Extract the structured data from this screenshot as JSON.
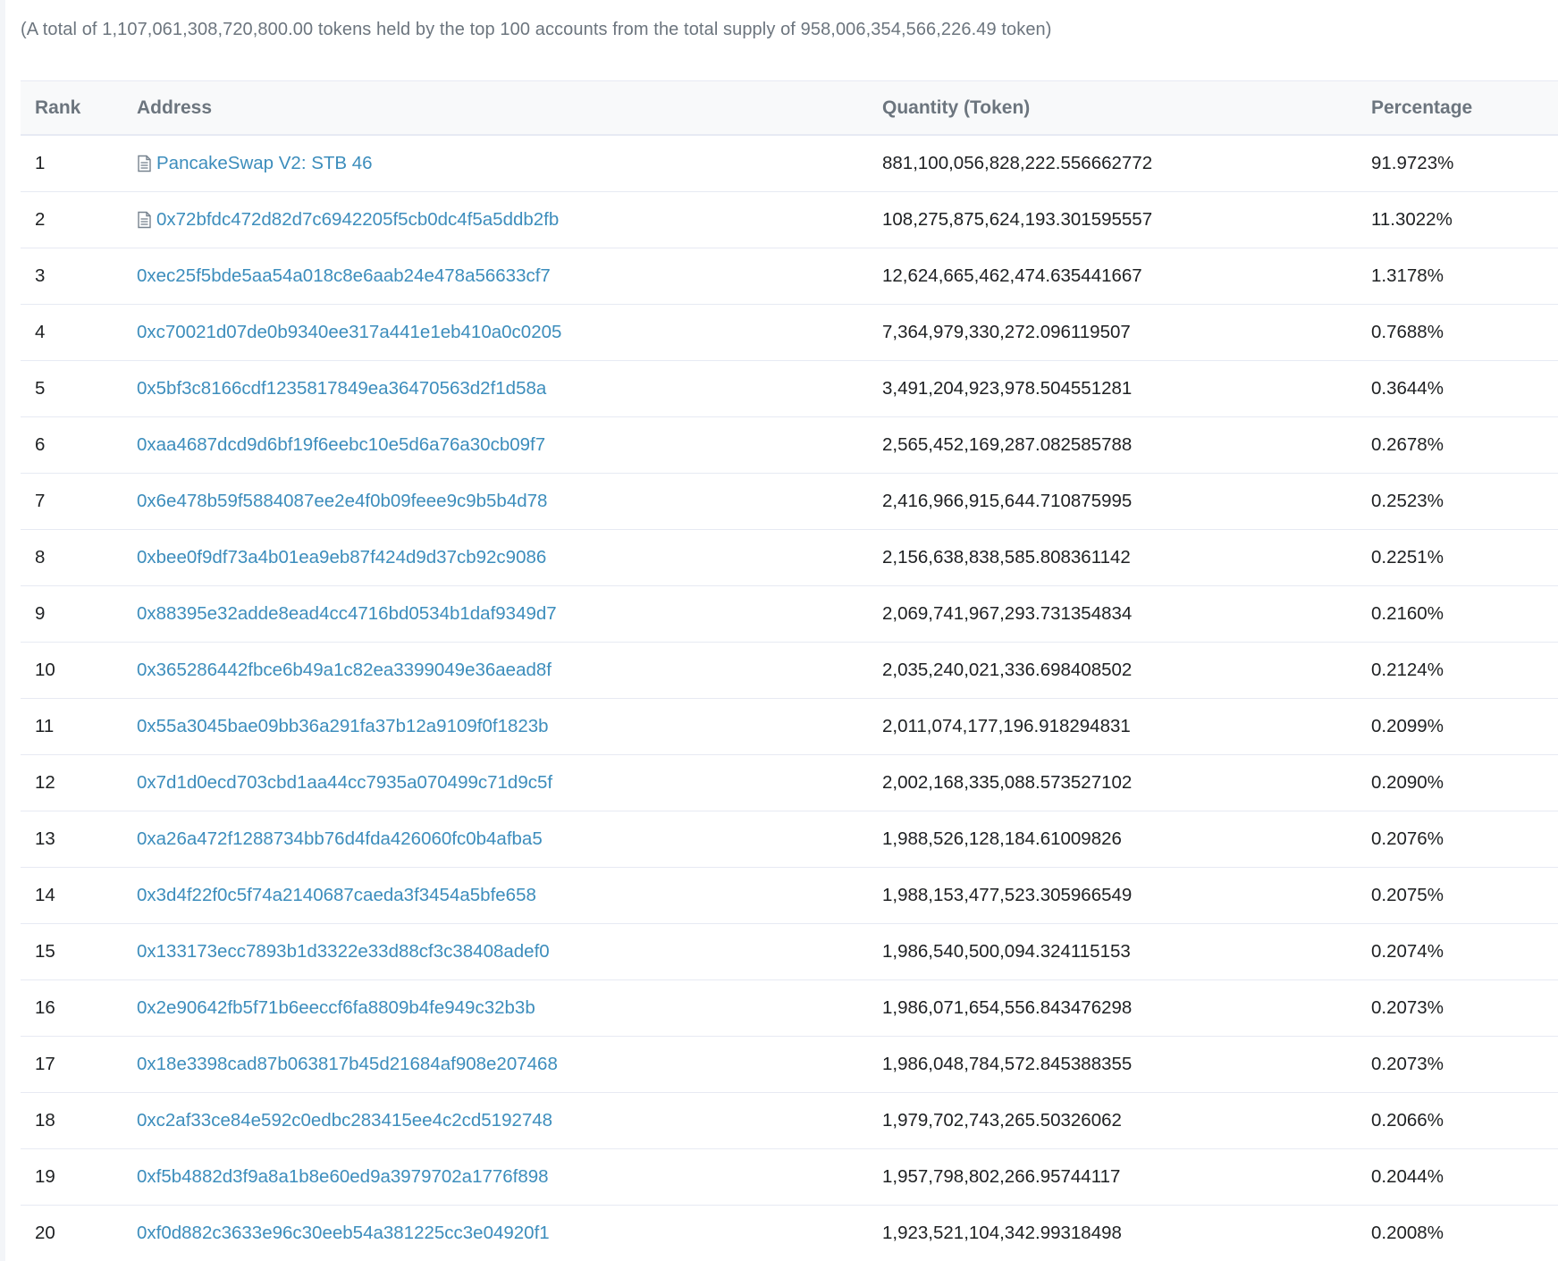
{
  "summary": "(A total of 1,107,061,308,720,800.00 tokens held by the top 100 accounts from the total supply of 958,006,354,566,226.49 token)",
  "columns": {
    "rank": "Rank",
    "address": "Address",
    "quantity": "Quantity (Token)",
    "percentage": "Percentage"
  },
  "rows": [
    {
      "rank": "1",
      "address": "PancakeSwap V2: STB 46",
      "is_contract": true,
      "quantity": "881,100,056,828,222.556662772",
      "percentage": "91.9723%"
    },
    {
      "rank": "2",
      "address": "0x72bfdc472d82d7c6942205f5cb0dc4f5a5ddb2fb",
      "is_contract": true,
      "quantity": "108,275,875,624,193.301595557",
      "percentage": "11.3022%"
    },
    {
      "rank": "3",
      "address": "0xec25f5bde5aa54a018c8e6aab24e478a56633cf7",
      "is_contract": false,
      "quantity": "12,624,665,462,474.635441667",
      "percentage": "1.3178%"
    },
    {
      "rank": "4",
      "address": "0xc70021d07de0b9340ee317a441e1eb410a0c0205",
      "is_contract": false,
      "quantity": "7,364,979,330,272.096119507",
      "percentage": "0.7688%"
    },
    {
      "rank": "5",
      "address": "0x5bf3c8166cdf1235817849ea36470563d2f1d58a",
      "is_contract": false,
      "quantity": "3,491,204,923,978.504551281",
      "percentage": "0.3644%"
    },
    {
      "rank": "6",
      "address": "0xaa4687dcd9d6bf19f6eebc10e5d6a76a30cb09f7",
      "is_contract": false,
      "quantity": "2,565,452,169,287.082585788",
      "percentage": "0.2678%"
    },
    {
      "rank": "7",
      "address": "0x6e478b59f5884087ee2e4f0b09feee9c9b5b4d78",
      "is_contract": false,
      "quantity": "2,416,966,915,644.710875995",
      "percentage": "0.2523%"
    },
    {
      "rank": "8",
      "address": "0xbee0f9df73a4b01ea9eb87f424d9d37cb92c9086",
      "is_contract": false,
      "quantity": "2,156,638,838,585.808361142",
      "percentage": "0.2251%"
    },
    {
      "rank": "9",
      "address": "0x88395e32adde8ead4cc4716bd0534b1daf9349d7",
      "is_contract": false,
      "quantity": "2,069,741,967,293.731354834",
      "percentage": "0.2160%"
    },
    {
      "rank": "10",
      "address": "0x365286442fbce6b49a1c82ea3399049e36aead8f",
      "is_contract": false,
      "quantity": "2,035,240,021,336.698408502",
      "percentage": "0.2124%"
    },
    {
      "rank": "11",
      "address": "0x55a3045bae09bb36a291fa37b12a9109f0f1823b",
      "is_contract": false,
      "quantity": "2,011,074,177,196.918294831",
      "percentage": "0.2099%"
    },
    {
      "rank": "12",
      "address": "0x7d1d0ecd703cbd1aa44cc7935a070499c71d9c5f",
      "is_contract": false,
      "quantity": "2,002,168,335,088.573527102",
      "percentage": "0.2090%"
    },
    {
      "rank": "13",
      "address": "0xa26a472f1288734bb76d4fda426060fc0b4afba5",
      "is_contract": false,
      "quantity": "1,988,526,128,184.61009826",
      "percentage": "0.2076%"
    },
    {
      "rank": "14",
      "address": "0x3d4f22f0c5f74a2140687caeda3f3454a5bfe658",
      "is_contract": false,
      "quantity": "1,988,153,477,523.305966549",
      "percentage": "0.2075%"
    },
    {
      "rank": "15",
      "address": "0x133173ecc7893b1d3322e33d88cf3c38408adef0",
      "is_contract": false,
      "quantity": "1,986,540,500,094.324115153",
      "percentage": "0.2074%"
    },
    {
      "rank": "16",
      "address": "0x2e90642fb5f71b6eeccf6fa8809b4fe949c32b3b",
      "is_contract": false,
      "quantity": "1,986,071,654,556.843476298",
      "percentage": "0.2073%"
    },
    {
      "rank": "17",
      "address": "0x18e3398cad87b063817b45d21684af908e207468",
      "is_contract": false,
      "quantity": "1,986,048,784,572.845388355",
      "percentage": "0.2073%"
    },
    {
      "rank": "18",
      "address": "0xc2af33ce84e592c0edbc283415ee4c2cd5192748",
      "is_contract": false,
      "quantity": "1,979,702,743,265.50326062",
      "percentage": "0.2066%"
    },
    {
      "rank": "19",
      "address": "0xf5b4882d3f9a8a1b8e60ed9a3979702a1776f898",
      "is_contract": false,
      "quantity": "1,957,798,802,266.95744117",
      "percentage": "0.2044%"
    },
    {
      "rank": "20",
      "address": "0xf0d882c3633e96c30eeb54a381225cc3e04920f1",
      "is_contract": false,
      "quantity": "1,923,521,104,342.99318498",
      "percentage": "0.2008%"
    }
  ],
  "icons": {
    "contract": "file-text-icon"
  }
}
